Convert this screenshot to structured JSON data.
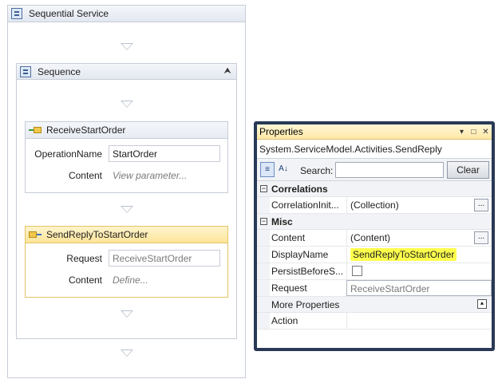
{
  "designer": {
    "title": "Sequential Service",
    "sequence": {
      "title": "Sequence",
      "collapse_glyph": "⮝"
    },
    "receive": {
      "title": "ReceiveStartOrder",
      "operation_label": "OperationName",
      "operation_value": "StartOrder",
      "content_label": "Content",
      "content_hint": "View parameter..."
    },
    "send_reply": {
      "title": "SendReplyToStartOrder",
      "request_label": "Request",
      "request_value": "ReceiveStartOrder",
      "content_label": "Content",
      "content_hint": "Define..."
    }
  },
  "properties": {
    "title": "Properties",
    "window_buttons": [
      "▾",
      "□",
      "✕"
    ],
    "object_type": "System.ServiceModel.Activities.SendReply",
    "toolbar": {
      "categorized_glyph": "≡",
      "alpha_glyph": "A↓",
      "search_label": "Search:",
      "search_value": "",
      "clear_label": "Clear"
    },
    "categories": [
      {
        "name": "Correlations",
        "toggle": "−",
        "rows": [
          {
            "name": "CorrelationInit...",
            "value": "(Collection)",
            "ellipsis": "..."
          }
        ]
      },
      {
        "name": "Misc",
        "toggle": "−",
        "rows": [
          {
            "name": "Content",
            "value": "(Content)",
            "ellipsis": "..."
          },
          {
            "name": "DisplayName",
            "value": "SendReplyToStartOrder"
          },
          {
            "name": "PersistBeforeS...",
            "value": ""
          },
          {
            "name": "Request",
            "value": "ReceiveStartOrder"
          }
        ]
      }
    ],
    "more_properties": {
      "label": "More Properties",
      "toggle": "⯅",
      "rows": [
        {
          "name": "Action",
          "value": ""
        }
      ]
    },
    "colors": {
      "frame": "#293955",
      "highlight": "#ffff4d",
      "title_bar": "#ffe8a6"
    }
  }
}
